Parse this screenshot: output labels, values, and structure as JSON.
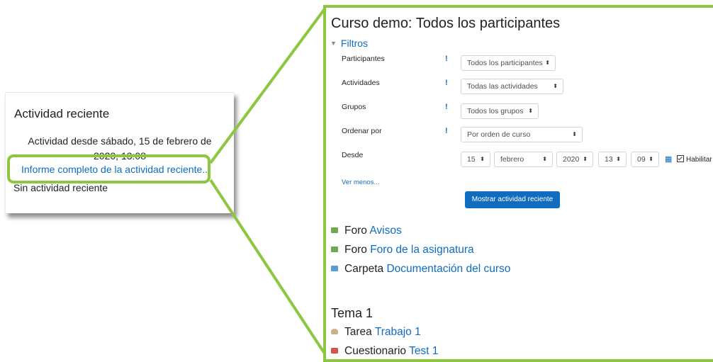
{
  "block": {
    "title": "Actividad reciente",
    "since_line1": "Actividad desde sábado, 15 de febrero de",
    "since_line2": "2020, 13:08",
    "full_report_link": "Informe completo de la actividad reciente...",
    "no_activity": "Sin actividad reciente"
  },
  "page": {
    "title": "Curso demo: Todos los participantes",
    "filters_toggle": "Filtros",
    "filters": {
      "participants_label": "Participantes",
      "participants_value": "Todos los participantes",
      "activities_label": "Actividades",
      "activities_value": "Todas las actividades",
      "groups_label": "Grupos",
      "groups_value": "Todos los grupos",
      "order_label": "Ordenar por",
      "order_value": "Por orden de curso",
      "from_label": "Desde",
      "day": "15",
      "month": "febrero",
      "year": "2020",
      "hour": "13",
      "minute": "09",
      "enable_label": "Habilitar",
      "help_mark": "!"
    },
    "show_less": "Ver menos...",
    "submit_button": "Mostrar actividad reciente",
    "activities": [
      {
        "type": "Foro",
        "name": "Avisos",
        "icon": "forum-icon"
      },
      {
        "type": "Foro",
        "name": "Foro de la asignatura",
        "icon": "forum-icon"
      },
      {
        "type": "Carpeta",
        "name": "Documentación del curso",
        "icon": "folder-icon"
      }
    ],
    "section_title": "Tema 1",
    "section_items": [
      {
        "type": "Tarea",
        "name": "Trabajo 1",
        "icon": "assignment-icon"
      },
      {
        "type": "Cuestionario",
        "name": "Test 1",
        "icon": "quiz-icon"
      }
    ]
  },
  "colors": {
    "highlight": "#8dc63f",
    "link": "#0f6cbf",
    "button": "#0f6cbf"
  }
}
